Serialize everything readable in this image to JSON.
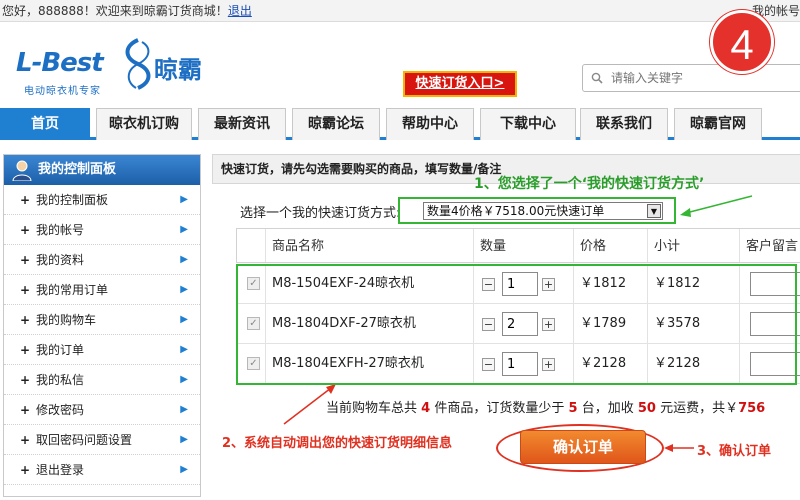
{
  "topbar": {
    "greeting": "您好，888888！欢迎来到晾霸订货商城！",
    "logout": "退出",
    "right_text": "我的帐号"
  },
  "header": {
    "logo_main": "L-Best",
    "logo_cn": "晾霸",
    "logo_sub": "电动晾衣机专家",
    "quick_entry": "快速订货入口>",
    "search_placeholder": "请输入关键字",
    "step_badge": "4"
  },
  "nav": {
    "tabs": [
      "首页",
      "晾衣机订购",
      "最新资讯",
      "晾霸论坛",
      "帮助中心",
      "下载中心",
      "联系我们",
      "晾霸官网"
    ]
  },
  "sidebar": {
    "title": "我的控制面板",
    "items": [
      "我的控制面板",
      "我的帐号",
      "我的资料",
      "我的常用订单",
      "我的购物车",
      "我的订单",
      "我的私信",
      "修改密码",
      "取回密码问题设置",
      "退出登录"
    ]
  },
  "main": {
    "title": "快速订货，请先勾选需要购买的商品，填写数量/备注",
    "method_label": "选择一个我的快速订货方式:",
    "method_value": "数量4价格￥7518.00元快速订单",
    "columns": [
      "商品名称",
      "数量",
      "价格",
      "小计",
      "客户留言"
    ],
    "rows": [
      {
        "name": "M8-1504EXF-24晾衣机",
        "qty": "1",
        "price": "￥1812",
        "subtotal": "￥1812"
      },
      {
        "name": "M8-1804DXF-27晾衣机",
        "qty": "2",
        "price": "￥1789",
        "subtotal": "￥3578"
      },
      {
        "name": "M8-1804EXFH-27晾衣机",
        "qty": "1",
        "price": "￥2128",
        "subtotal": "￥2128"
      }
    ],
    "summary": {
      "p1": "当前购物车总共",
      "count": "4",
      "p2": "件商品，订货数量少于",
      "min": "5",
      "p3": "台，加收",
      "fee": "50",
      "p4": "元运费，共￥",
      "total": "756"
    },
    "confirm": "确认订单"
  },
  "annotations": {
    "a1": "1、您选择了一个‘我的快速订货方式’",
    "a2": "2、系统自动调出您的快速订货明细信息",
    "a3": "3、确认订单"
  },
  "colors": {
    "accent_blue": "#1f7fd0",
    "annotation_green": "#2a9e2a",
    "annotation_red": "#e03020",
    "quick_entry_red": "#d8160f",
    "confirm_orange": "#e0561a"
  }
}
